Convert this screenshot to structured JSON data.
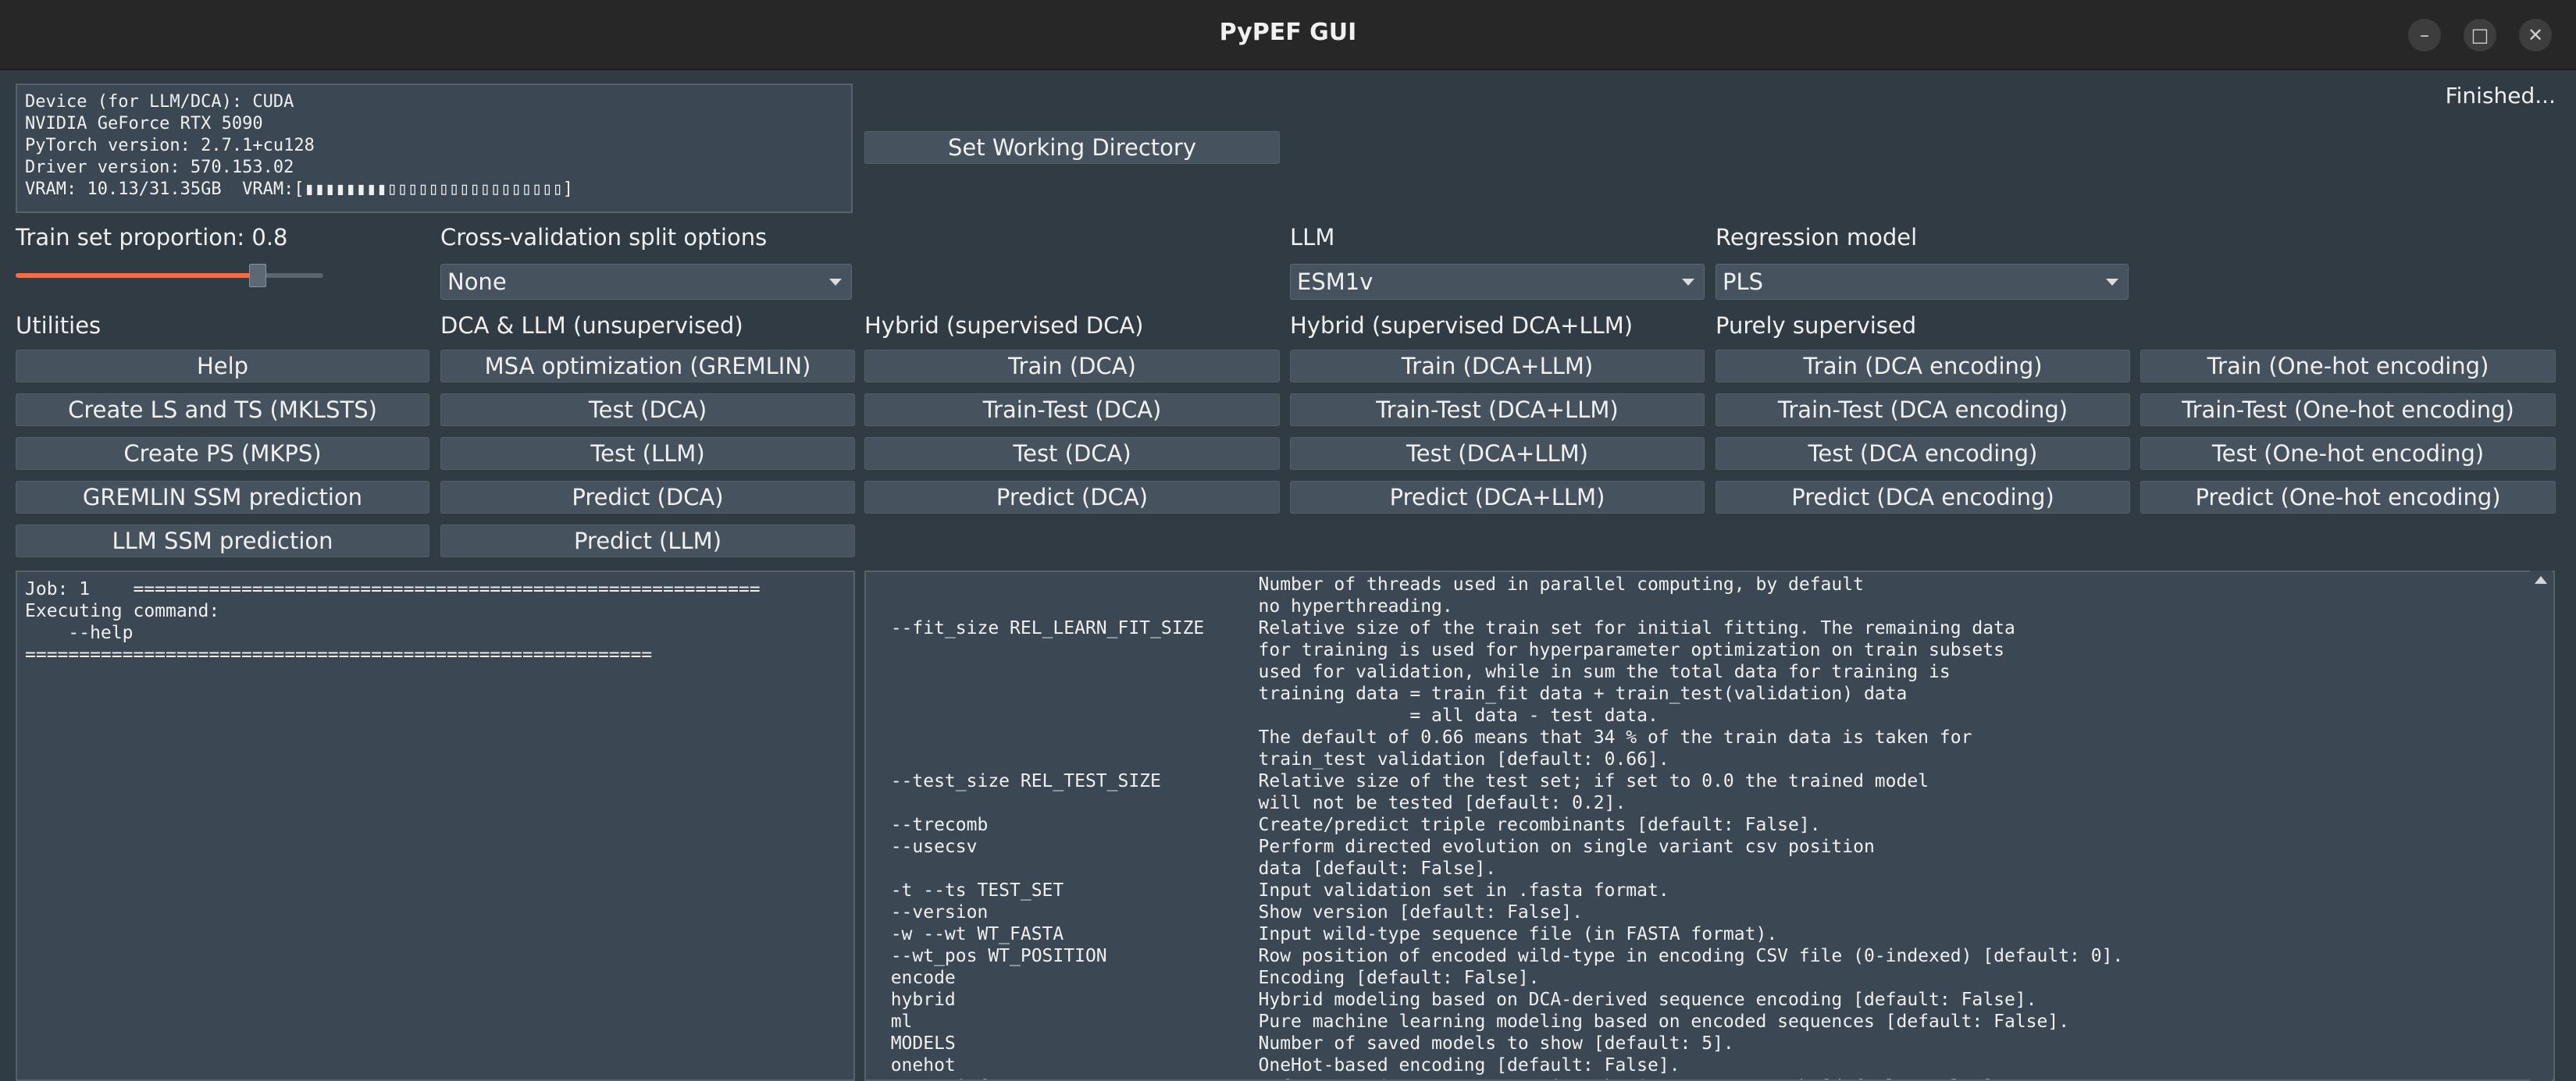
{
  "window": {
    "title": "PyPEF GUI",
    "minimize": "–",
    "maximize": "□",
    "close": "✕"
  },
  "device_info": "Device (for LLM/DCA): CUDA\nNVIDIA GeForce RTX 5090\nPyTorch version: 2.7.1+cu128\nDriver version: 570.153.02\nVRAM: 10.13/31.35GB  VRAM:[▮▮▮▮▮▮▮▮▯▯▯▯▯▯▯▯▯▯▯▯▯▯▯▯▯]",
  "status": "Finished...",
  "working_dir_button": "Set Working Directory",
  "train_proportion": {
    "label": "Train set proportion: 0.8",
    "value": 0.8
  },
  "cv": {
    "label": "Cross-validation split options",
    "selected": "None"
  },
  "llm": {
    "label": "LLM",
    "selected": "ESM1v"
  },
  "regression": {
    "label": "Regression model",
    "selected": "PLS"
  },
  "colors": {
    "accent": "#ff6b3d",
    "background": "#313b44",
    "button": "#46535f"
  },
  "columns": [
    {
      "heading": "Utilities",
      "buttons": [
        "Help",
        "Create LS and TS (MKLSTS)",
        "Create PS (MKPS)",
        "GREMLIN SSM prediction",
        "LLM SSM prediction"
      ]
    },
    {
      "heading": "DCA & LLM (unsupervised)",
      "buttons": [
        "MSA optimization (GREMLIN)",
        "Test (DCA)",
        "Test (LLM)",
        "Predict (DCA)",
        "Predict (LLM)"
      ]
    },
    {
      "heading": "Hybrid (supervised DCA)",
      "buttons": [
        "Train (DCA)",
        "Train-Test (DCA)",
        "Test (DCA)",
        "Predict (DCA)"
      ]
    },
    {
      "heading": "Hybrid (supervised DCA+LLM)",
      "buttons": [
        "Train (DCA+LLM)",
        "Train-Test (DCA+LLM)",
        "Test (DCA+LLM)",
        "Predict (DCA+LLM)"
      ]
    },
    {
      "heading": "Purely supervised",
      "buttons": [
        "Train (DCA encoding)",
        "Train-Test (DCA encoding)",
        "Test (DCA encoding)",
        "Predict (DCA encoding)"
      ]
    },
    {
      "heading": "",
      "buttons": [
        "Train (One-hot encoding)",
        "Train-Test (One-hot encoding)",
        "Test (One-hot encoding)",
        "Predict (One-hot encoding)"
      ]
    }
  ],
  "job_log": "Job: 1    ==========================================================\nExecuting command:\n    --help\n==========================================================",
  "help_output": "                                    Number of threads used in parallel computing, by default\n                                    no hyperthreading.\n  --fit_size REL_LEARN_FIT_SIZE     Relative size of the train set for initial fitting. The remaining data\n                                    for training is used for hyperparameter optimization on train subsets\n                                    used for validation, while in sum the total data for training is\n                                    training data = train_fit data + train_test(validation) data\n                                                  = all data - test data.\n                                    The default of 0.66 means that 34 % of the train data is taken for\n                                    train_test validation [default: 0.66].\n  --test_size REL_TEST_SIZE         Relative size of the test set; if set to 0.0 the trained model\n                                    will not be tested [default: 0.2].\n  --trecomb                         Create/predict triple recombinants [default: False].\n  --usecsv                          Perform directed evolution on single variant csv position\n                                    data [default: False].\n  -t --ts TEST_SET                  Input validation set in .fasta format.\n  --version                         Show version [default: False].\n  -w --wt WT_FASTA                  Input wild-type sequence file (in FASTA format).\n  --wt_pos WT_POSITION              Row position of encoded wild-type in encoding CSV file (0-indexed) [default: 0].\n  encode                            Encoding [default: False].\n  hybrid                            Hybrid modeling based on DCA-derived sequence encoding [default: False].\n  ml                                Pure machine learning modeling based on encoded sequences [default: False].\n  MODELS                            Number of saved models to show [default: 5].\n  onehot                            OneHot-based encoding [default: False].\n  param_inference                   Inference DCA parameters using the GREMLIN approach [default: False]."
}
